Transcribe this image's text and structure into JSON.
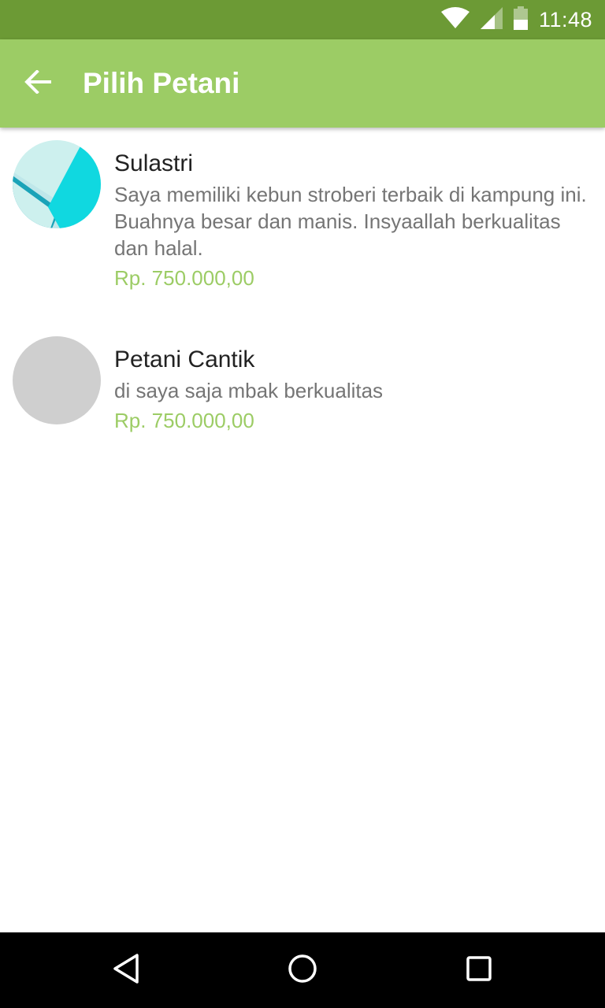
{
  "status_bar": {
    "time": "11:48",
    "icons": [
      "wifi-icon",
      "signal-icon",
      "battery-icon"
    ],
    "color": "#6c9a35"
  },
  "app_bar": {
    "back_icon": "arrow-back-icon",
    "title": "Pilih Petani",
    "color": "#9ccc65"
  },
  "farmers": [
    {
      "name": "Sulastri",
      "description": "Saya memiliki kebun stroberi terbaik di kampung ini. Buahnya besar dan manis. Insyaallah berkualitas dan halal.",
      "price": "Rp. 750.000,00",
      "avatar": "material-wallpaper-avatar"
    },
    {
      "name": "Petani Cantik",
      "description": "di saya saja mbak berkualitas",
      "price": "Rp. 750.000,00",
      "avatar": "placeholder-avatar"
    }
  ],
  "nav_bar": {
    "buttons": [
      "back-triangle-icon",
      "home-circle-icon",
      "recents-square-icon"
    ]
  },
  "colors": {
    "accent": "#9ccc65",
    "primary_dark": "#6c9a35",
    "text_primary": "#222222",
    "text_secondary": "#757575"
  }
}
